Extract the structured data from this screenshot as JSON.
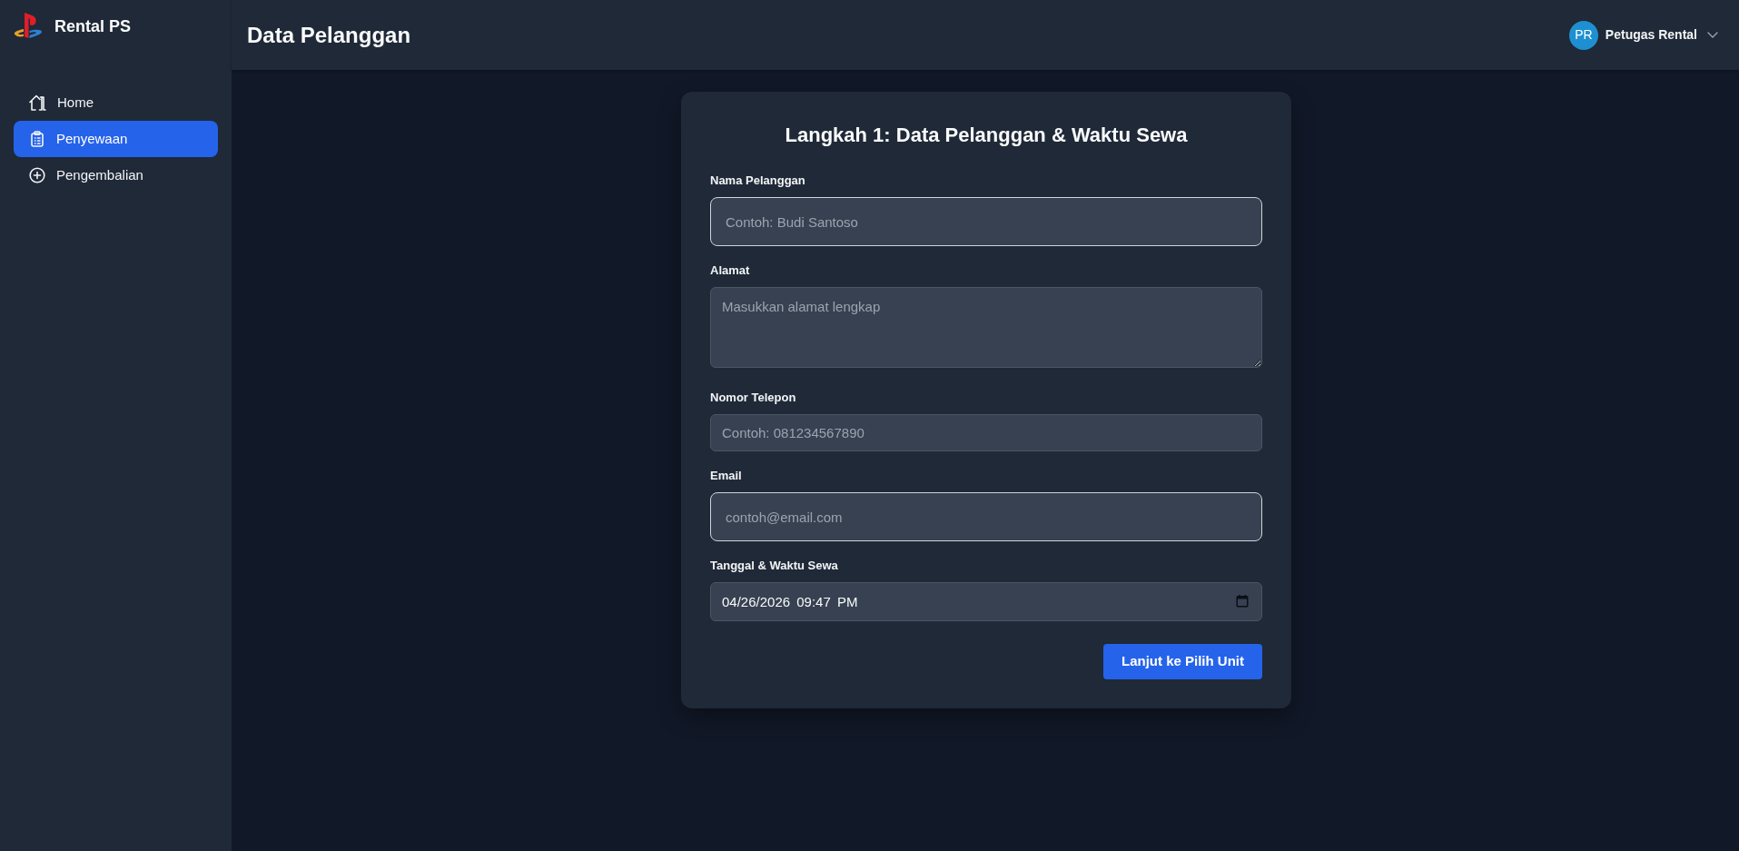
{
  "sidebar": {
    "brand": "Rental PS",
    "items": [
      {
        "label": "Home",
        "selected": false
      },
      {
        "label": "Penyewaan",
        "selected": true
      },
      {
        "label": "Pengembalian",
        "selected": false
      }
    ]
  },
  "header": {
    "title": "Data Pelanggan",
    "user": {
      "initials": "PR",
      "name": "Petugas Rental"
    }
  },
  "form": {
    "title": "Langkah 1: Data Pelanggan & Waktu Sewa",
    "fields": [
      {
        "kind": "boxed",
        "label": "Nama Pelanggan",
        "placeholder": "Contoh: Budi Santoso"
      },
      {
        "kind": "area",
        "label": "Alamat",
        "placeholder": "Masukkan alamat lengkap"
      },
      {
        "kind": "plain",
        "label": "Nomor Telepon",
        "placeholder": "Contoh: 081234567890"
      },
      {
        "kind": "boxed",
        "label": "Email",
        "placeholder": "contoh@email.com"
      },
      {
        "kind": "datetime",
        "label": "Tanggal & Waktu Sewa",
        "value": "04/26/2026 09:47 PM"
      }
    ],
    "button": "Lanjut ke Pilih Unit"
  }
}
